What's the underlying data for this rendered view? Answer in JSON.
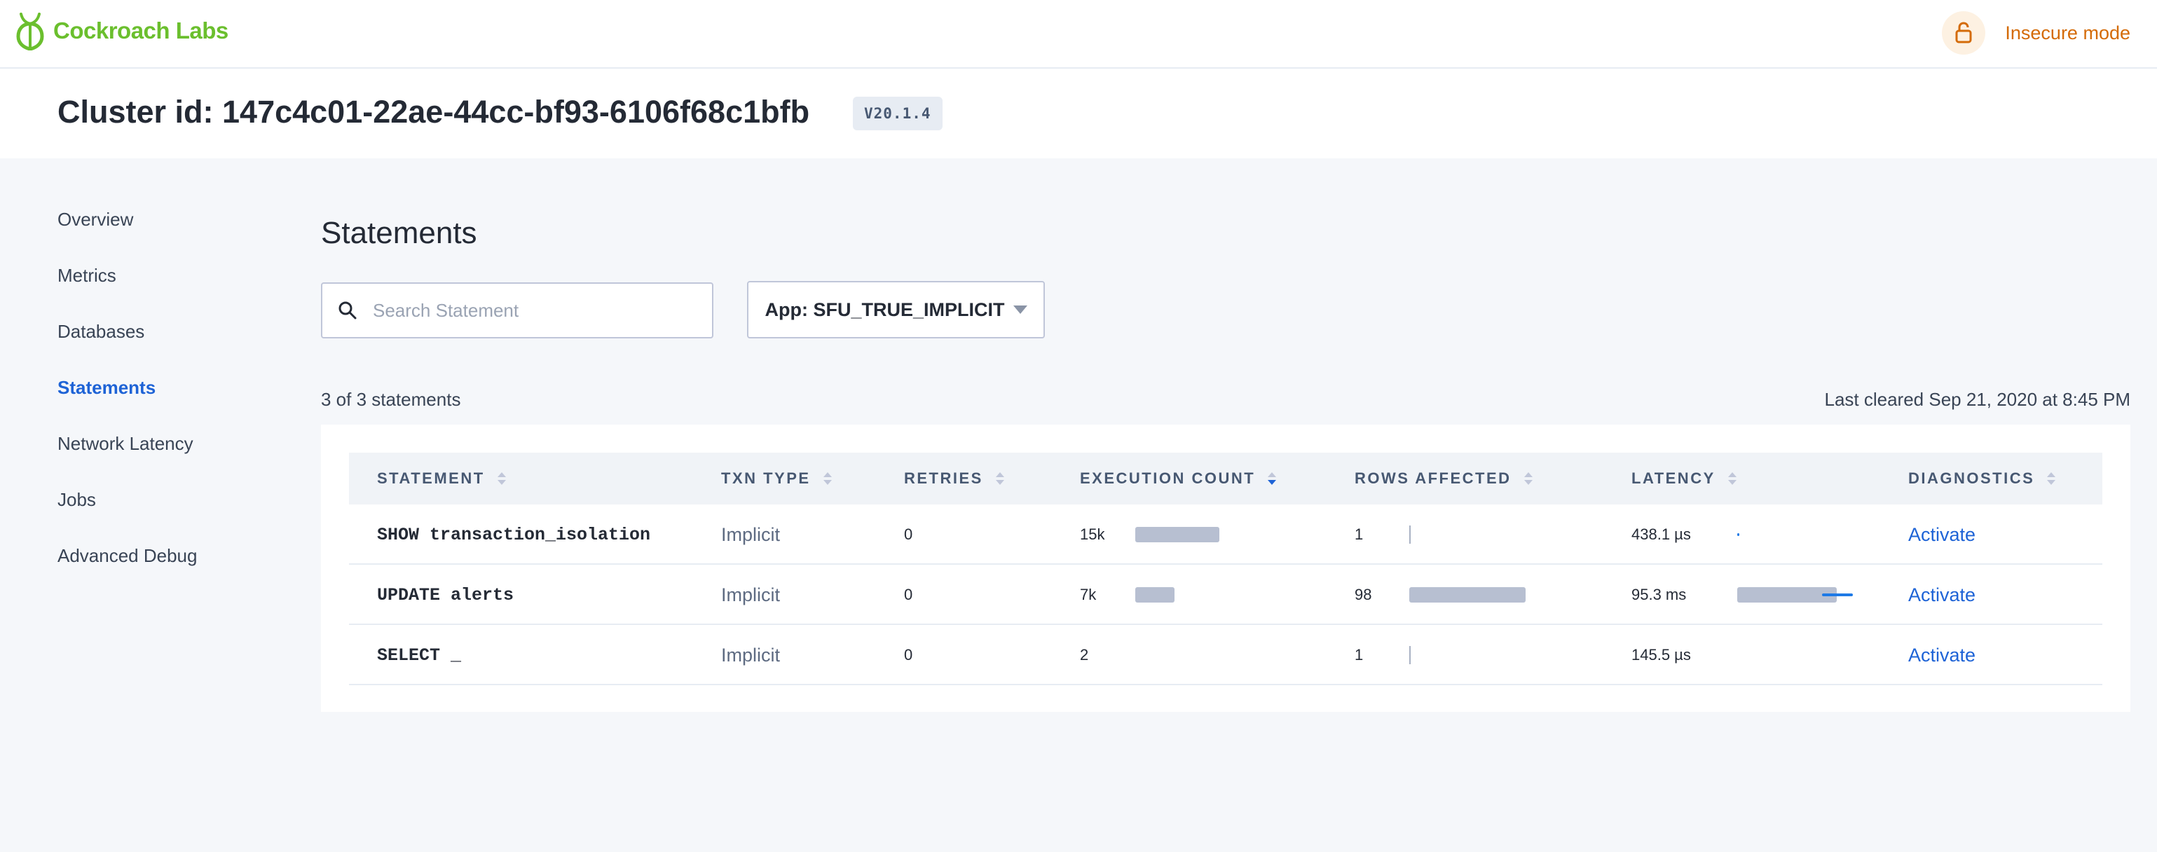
{
  "header": {
    "brand": "Cockroach Labs",
    "insecure_label": "Insecure mode",
    "lock_icon": "lock-icon",
    "brand_color": "#6bbf2e",
    "warning_color": "#d46b08"
  },
  "cluster": {
    "title": "Cluster id: 147c4c01-22ae-44cc-bf93-6106f68c1bfb",
    "version": "V20.1.4"
  },
  "sidebar": {
    "items": [
      {
        "label": "Overview",
        "active": false
      },
      {
        "label": "Metrics",
        "active": false
      },
      {
        "label": "Databases",
        "active": false
      },
      {
        "label": "Statements",
        "active": true
      },
      {
        "label": "Network Latency",
        "active": false
      },
      {
        "label": "Jobs",
        "active": false
      },
      {
        "label": "Advanced Debug",
        "active": false
      }
    ]
  },
  "page": {
    "title": "Statements",
    "search_placeholder": "Search Statement",
    "search_value": "",
    "app_filter_label": "App: SFU_TRUE_IMPLICIT",
    "count_text": "3 of 3 statements",
    "cleared_text": "Last cleared Sep 21, 2020 at 8:45 PM"
  },
  "table": {
    "columns": [
      "STATEMENT",
      "TXN TYPE",
      "RETRIES",
      "EXECUTION COUNT",
      "ROWS AFFECTED",
      "LATENCY",
      "DIAGNOSTICS"
    ],
    "sorted_column": "EXECUTION COUNT",
    "sort_direction": "descending",
    "rows": [
      {
        "statement": "SHOW transaction_isolation",
        "txn_type": "Implicit",
        "retries": "0",
        "exec_count": "15k",
        "exec_ratio": 1.0,
        "rows_affected": "1",
        "rows_ratio": 0.01,
        "latency": "438.1 µs",
        "latency_ratio": 0.005,
        "diagnostics": "Activate"
      },
      {
        "statement": "UPDATE alerts",
        "txn_type": "Implicit",
        "retries": "0",
        "exec_count": "7k",
        "exec_ratio": 0.47,
        "rows_affected": "98",
        "rows_ratio": 1.0,
        "latency": "95.3 ms",
        "latency_ratio": 1.0,
        "diagnostics": "Activate"
      },
      {
        "statement": "SELECT _",
        "txn_type": "Implicit",
        "retries": "0",
        "exec_count": "2",
        "exec_ratio": 0.0,
        "rows_affected": "1",
        "rows_ratio": 0.01,
        "latency": "145.5 µs",
        "latency_ratio": 0.0,
        "diagnostics": "Activate"
      }
    ]
  }
}
